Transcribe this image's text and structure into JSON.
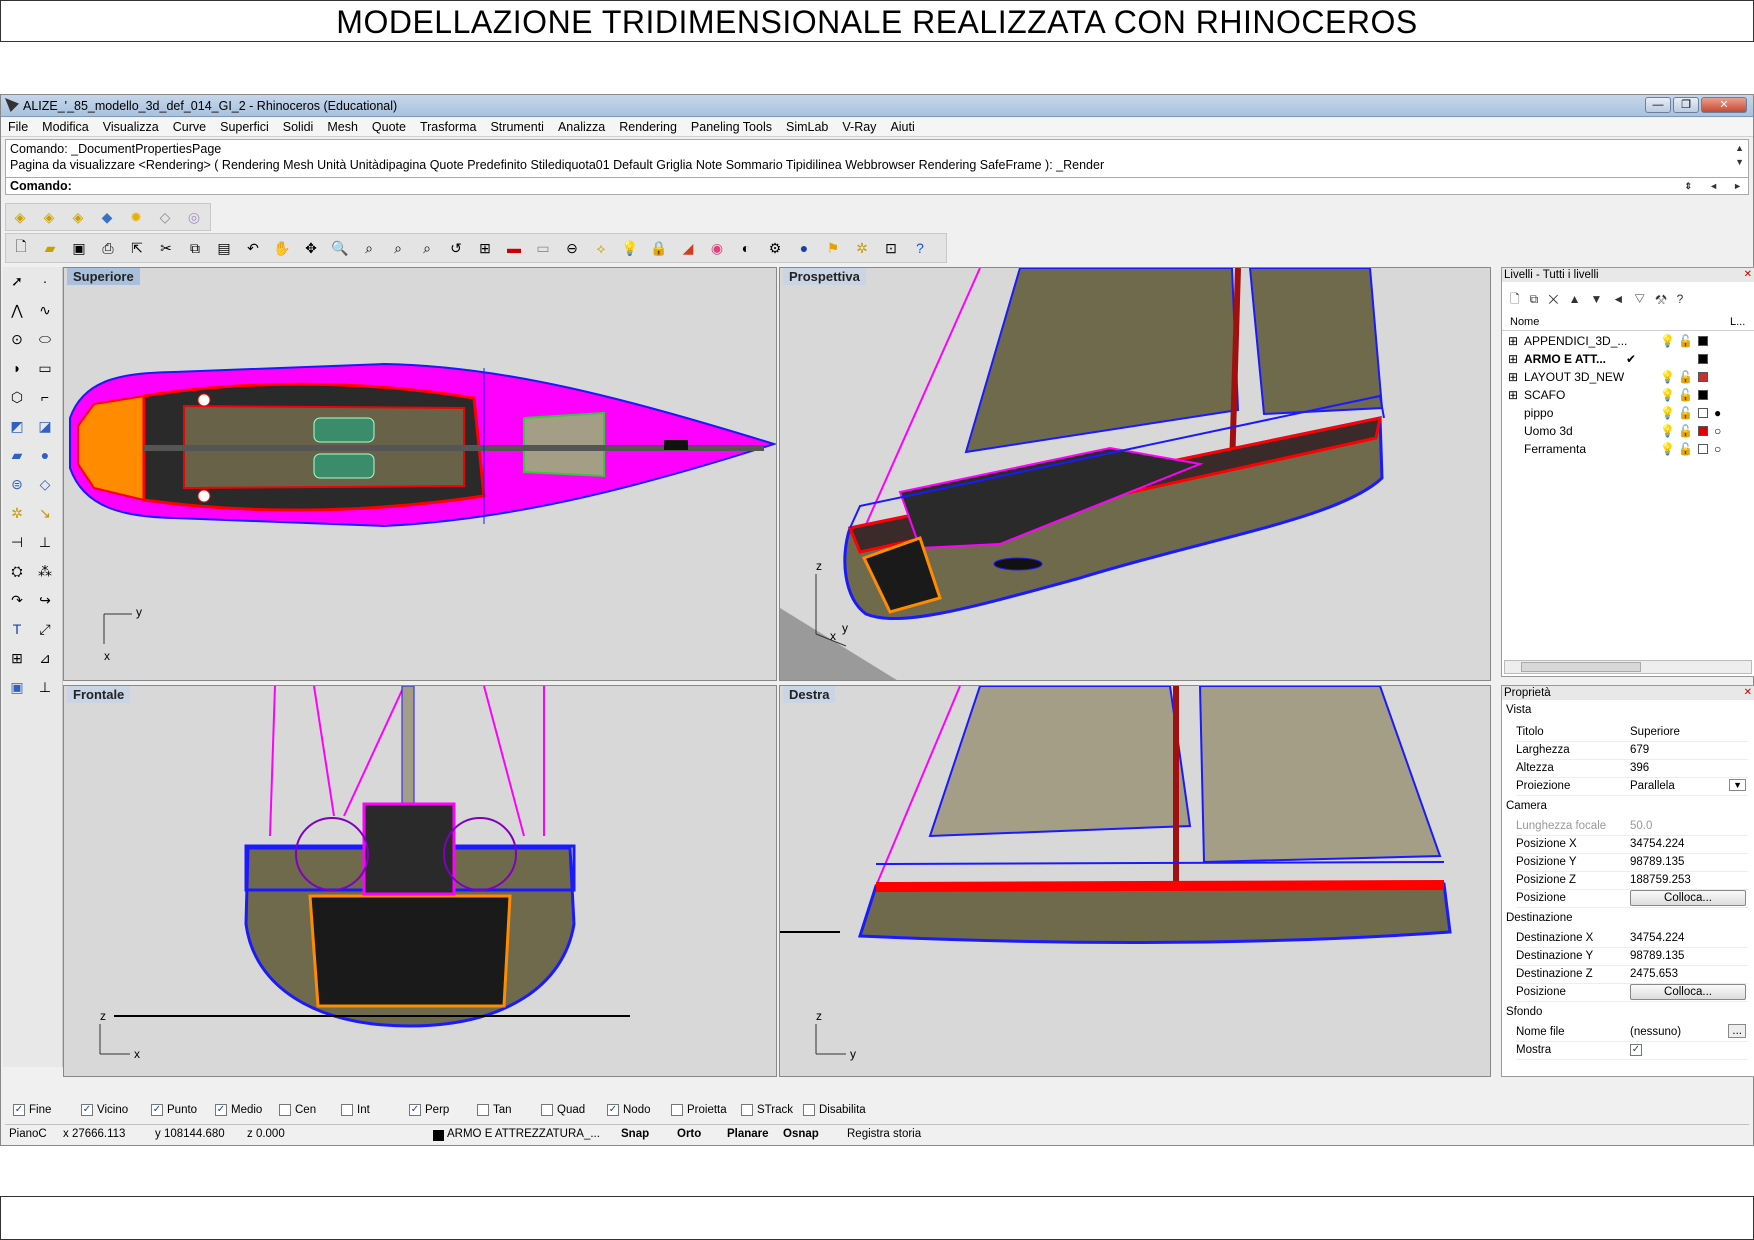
{
  "page_title": "MODELLAZIONE TRIDIMENSIONALE  REALIZZATA  CON RHINOCEROS",
  "window": {
    "title": "ALIZE_'_85_modello_3d_def_014_GI_2 - Rhinoceros (Educational)",
    "min": "—",
    "restore": "❐",
    "close": "✕"
  },
  "menu": [
    "File",
    "Modifica",
    "Visualizza",
    "Curve",
    "Superfici",
    "Solidi",
    "Mesh",
    "Quote",
    "Trasforma",
    "Strumenti",
    "Analizza",
    "Rendering",
    "Paneling Tools",
    "SimLab",
    "V-Ray",
    "Aiuti"
  ],
  "command": {
    "line1": "Comando: _DocumentPropertiesPage",
    "line2": "Pagina da visualizzare <Rendering> ( Rendering  Mesh  Unità  Unitàdipagina  Quote  Predefinito  Stilediquota01  Default  Griglia  Note  Sommario  Tipidilinea  Webbrowser  Rendering  SafeFrame ): _Render",
    "prompt": "Comando:"
  },
  "viewports": {
    "top": "Superiore",
    "perspective": "Prospettiva",
    "front": "Frontale",
    "right": "Destra"
  },
  "axis_labels": {
    "top": [
      "y",
      "x"
    ],
    "perspective": [
      "z",
      "x",
      "y"
    ],
    "front": [
      "z",
      "x"
    ],
    "right": [
      "z",
      "y"
    ]
  },
  "layers": {
    "title": "Livelli - Tutti i livelli",
    "col_name": "Nome",
    "col_l": "L...",
    "items": [
      {
        "name": "APPENDICI_3D_...",
        "color": "#000000",
        "bold": false,
        "expand": "⊞"
      },
      {
        "name": "ARMO E ATT...",
        "color": "#000000",
        "bold": true,
        "expand": "⊞",
        "check": "✔"
      },
      {
        "name": "LAYOUT 3D_NEW",
        "color": "#c83030",
        "bold": false,
        "expand": "⊞"
      },
      {
        "name": "SCAFO",
        "color": "#000000",
        "bold": false,
        "expand": "⊞"
      },
      {
        "name": "pippo",
        "color": "#ffffff",
        "bold": false
      },
      {
        "name": "Uomo 3d",
        "color": "#e00000",
        "bold": false
      },
      {
        "name": "Ferramenta",
        "color": "#ffffff",
        "bold": false
      }
    ]
  },
  "properties": {
    "title": "Proprietà",
    "sections": {
      "vista": "Vista",
      "camera": "Camera",
      "dest": "Destinazione",
      "sfondo": "Sfondo"
    },
    "titolo_k": "Titolo",
    "titolo_v": "Superiore",
    "larghezza_k": "Larghezza",
    "larghezza_v": "679",
    "altezza_k": "Altezza",
    "altezza_v": "396",
    "proiezione_k": "Proiezione",
    "proiezione_v": "Parallela",
    "focale_k": "Lunghezza focale",
    "focale_v": "50.0",
    "px_k": "Posizione X",
    "px_v": "34754.224",
    "py_k": "Posizione Y",
    "py_v": "98789.135",
    "pz_k": "Posizione Z",
    "pz_v": "188759.253",
    "pos_k": "Posizione",
    "pos_btn": "Colloca...",
    "dx_k": "Destinazione X",
    "dx_v": "34754.224",
    "dy_k": "Destinazione Y",
    "dy_v": "98789.135",
    "dz_k": "Destinazione Z",
    "dz_v": "2475.653",
    "pos2_k": "Posizione",
    "pos2_btn": "Colloca...",
    "file_k": "Nome file",
    "file_v": "(nessuno)",
    "file_btn": "...",
    "mostra_k": "Mostra",
    "mostra_v": "✓"
  },
  "osnap": [
    {
      "label": "Fine",
      "checked": true
    },
    {
      "label": "Vicino",
      "checked": true
    },
    {
      "label": "Punto",
      "checked": true
    },
    {
      "label": "Medio",
      "checked": true
    },
    {
      "label": "Cen",
      "checked": false
    },
    {
      "label": "Int",
      "checked": false
    },
    {
      "label": "Perp",
      "checked": true
    },
    {
      "label": "Tan",
      "checked": false
    },
    {
      "label": "Quad",
      "checked": false
    },
    {
      "label": "Nodo",
      "checked": true
    },
    {
      "label": "Proietta",
      "checked": false
    },
    {
      "label": "STrack",
      "checked": false
    },
    {
      "label": "Disabilita",
      "checked": false
    }
  ],
  "status": {
    "plane": "PianoC",
    "x": "x 27666.113",
    "y": "y 108144.680",
    "z": "z 0.000",
    "layer": "ARMO E ATTREZZATURA_...",
    "snap": "Snap",
    "orto": "Orto",
    "planare": "Planare",
    "osnap": "Osnap",
    "storia": "Registra storia"
  },
  "colors": {
    "hull": "#ff00ff",
    "outline": "#ff0000",
    "blue": "#1a1aff",
    "orange": "#ff8c00",
    "sail": "#a49e87",
    "hullside": "#6f6a4c",
    "viewport_bg": "#d8d8d8"
  }
}
